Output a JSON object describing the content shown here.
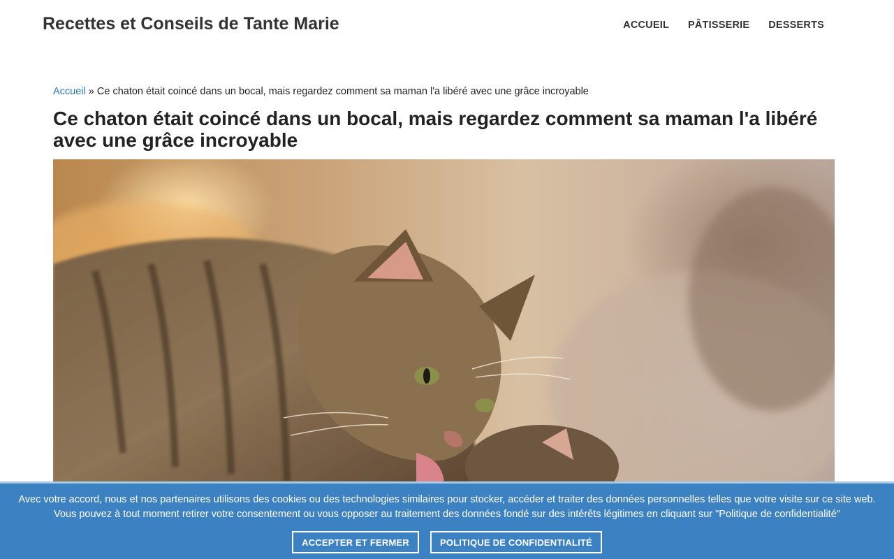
{
  "header": {
    "site_title": "Recettes et Conseils de Tante Marie",
    "nav": [
      {
        "label": "ACCUEIL"
      },
      {
        "label": "PÂTISSERIE"
      },
      {
        "label": "DESSERTS"
      }
    ]
  },
  "breadcrumb": {
    "home_label": "Accueil",
    "separator": " » ",
    "current": "Ce chaton était coincé dans un bocal, mais regardez comment sa maman l'a libéré avec une grâce incroyable"
  },
  "article": {
    "title": "Ce chaton était coincé dans un bocal, mais regardez comment sa maman l'a libéré avec une grâce incroyable"
  },
  "cookie_banner": {
    "text": "Avec votre accord, nous et nos partenaires utilisons des cookies ou des technologies similaires pour stocker, accéder et traiter des données personnelles telles que votre visite sur ce site web. Vous pouvez à tout moment retirer votre consentement ou vous opposer au traitement des données fondé sur des intérêts légitimes en cliquant sur \"Politique de confidentialité\"",
    "accept_label": "ACCEPTER ET FERMER",
    "policy_label": "POLITIQUE DE CONFIDENTIALITÉ"
  },
  "colors": {
    "link": "#2a7ab8",
    "cookie_banner_bg": "#3c82c2",
    "text": "#222222"
  }
}
